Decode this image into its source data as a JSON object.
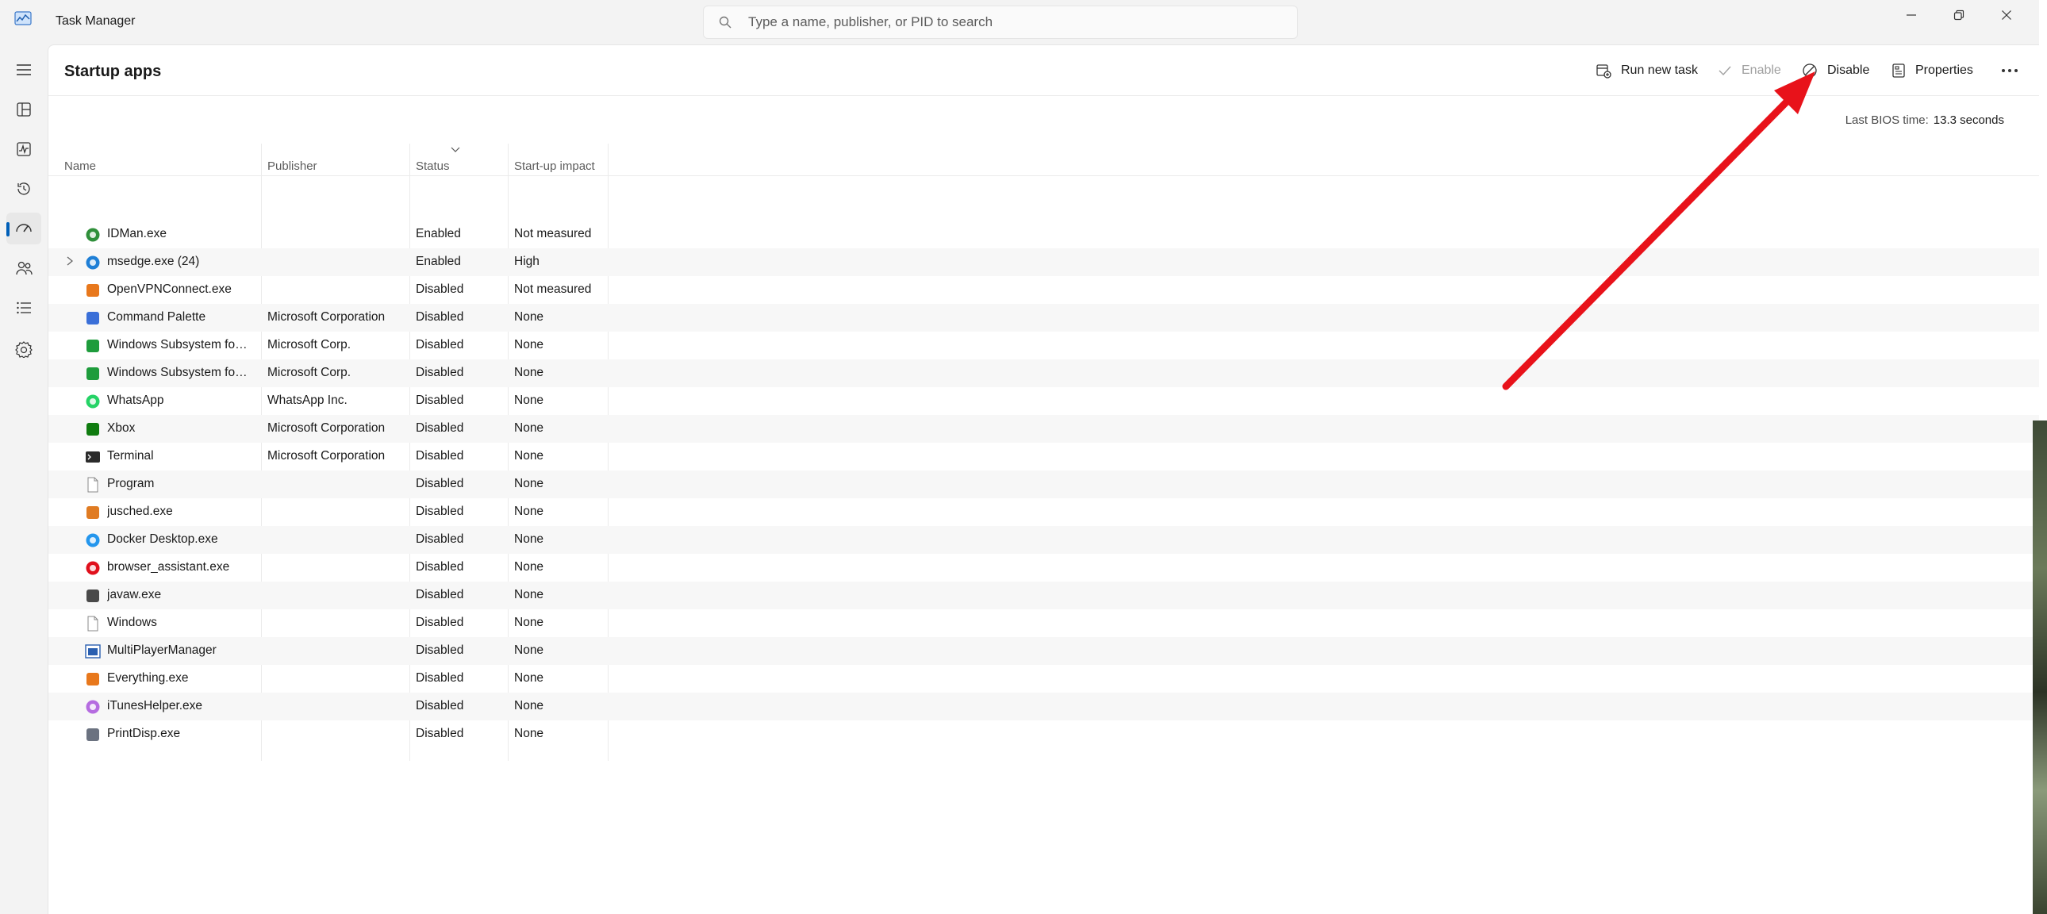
{
  "window": {
    "title": "Task Manager",
    "search_placeholder": "Type a name, publisher, or PID to search",
    "search_value": ""
  },
  "nav": {
    "items": [
      {
        "name": "menu",
        "icon": "hamburger-icon"
      },
      {
        "name": "processes",
        "icon": "processes-icon"
      },
      {
        "name": "performance",
        "icon": "performance-icon"
      },
      {
        "name": "app-history",
        "icon": "history-icon"
      },
      {
        "name": "startup-apps",
        "icon": "startup-icon",
        "active": true
      },
      {
        "name": "users",
        "icon": "users-icon"
      },
      {
        "name": "details",
        "icon": "details-icon"
      },
      {
        "name": "services",
        "icon": "services-icon"
      }
    ]
  },
  "page": {
    "title": "Startup apps",
    "toolbar": {
      "run_new_task": "Run new task",
      "enable": "Enable",
      "disable": "Disable",
      "properties": "Properties"
    },
    "bios_label": "Last BIOS time:",
    "bios_value": "13.3 seconds"
  },
  "table": {
    "columns": {
      "name": "Name",
      "publisher": "Publisher",
      "status": "Status",
      "impact": "Start-up impact"
    },
    "rows": [
      {
        "name": "IDMan.exe",
        "publisher": "",
        "status": "Enabled",
        "impact": "Not measured",
        "icon": "idman-icon",
        "color": "#2f8f3a"
      },
      {
        "name": "msedge.exe (24)",
        "publisher": "",
        "status": "Enabled",
        "impact": "High",
        "icon": "edge-icon",
        "color": "#1f7fd6",
        "expandable": true
      },
      {
        "name": "OpenVPNConnect.exe",
        "publisher": "",
        "status": "Disabled",
        "impact": "Not measured",
        "icon": "openvpn-icon",
        "color": "#e8781c"
      },
      {
        "name": "Command Palette",
        "publisher": "Microsoft Corporation",
        "status": "Disabled",
        "impact": "None",
        "icon": "command-palette-icon",
        "color": "#3a6fd8"
      },
      {
        "name": "Windows Subsystem for A...",
        "publisher": "Microsoft Corp.",
        "status": "Disabled",
        "impact": "None",
        "icon": "wsa-icon",
        "color": "#1e9c3c"
      },
      {
        "name": "Windows Subsystem for A...",
        "publisher": "Microsoft Corp.",
        "status": "Disabled",
        "impact": "None",
        "icon": "wsa-icon",
        "color": "#1e9c3c"
      },
      {
        "name": "WhatsApp",
        "publisher": "WhatsApp Inc.",
        "status": "Disabled",
        "impact": "None",
        "icon": "whatsapp-icon",
        "color": "#25d366"
      },
      {
        "name": "Xbox",
        "publisher": "Microsoft Corporation",
        "status": "Disabled",
        "impact": "None",
        "icon": "xbox-icon",
        "color": "#107c10"
      },
      {
        "name": "Terminal",
        "publisher": "Microsoft Corporation",
        "status": "Disabled",
        "impact": "None",
        "icon": "terminal-icon",
        "color": "#2b2b2b"
      },
      {
        "name": "Program",
        "publisher": "",
        "status": "Disabled",
        "impact": "None",
        "icon": "file-icon",
        "color": "#ffffff"
      },
      {
        "name": "jusched.exe",
        "publisher": "",
        "status": "Disabled",
        "impact": "None",
        "icon": "java-icon",
        "color": "#e07b22"
      },
      {
        "name": "Docker Desktop.exe",
        "publisher": "",
        "status": "Disabled",
        "impact": "None",
        "icon": "docker-icon",
        "color": "#2496ed"
      },
      {
        "name": "browser_assistant.exe",
        "publisher": "",
        "status": "Disabled",
        "impact": "None",
        "icon": "opera-icon",
        "color": "#e0101c"
      },
      {
        "name": "javaw.exe",
        "publisher": "",
        "status": "Disabled",
        "impact": "None",
        "icon": "javaw-icon",
        "color": "#4a4a4a"
      },
      {
        "name": "Windows",
        "publisher": "",
        "status": "Disabled",
        "impact": "None",
        "icon": "file-icon",
        "color": "#ffffff"
      },
      {
        "name": "MultiPlayerManager",
        "publisher": "",
        "status": "Disabled",
        "impact": "None",
        "icon": "window-app-icon",
        "color": "#2a5fb0"
      },
      {
        "name": "Everything.exe",
        "publisher": "",
        "status": "Disabled",
        "impact": "None",
        "icon": "everything-icon",
        "color": "#e8781c"
      },
      {
        "name": "iTunesHelper.exe",
        "publisher": "",
        "status": "Disabled",
        "impact": "None",
        "icon": "itunes-icon",
        "color": "#b56ce0"
      },
      {
        "name": "PrintDisp.exe",
        "publisher": "",
        "status": "Disabled",
        "impact": "None",
        "icon": "printer-icon",
        "color": "#6b7280"
      }
    ]
  },
  "colors": {
    "accent": "#005fb8",
    "annotation_arrow": "#e8121a"
  }
}
